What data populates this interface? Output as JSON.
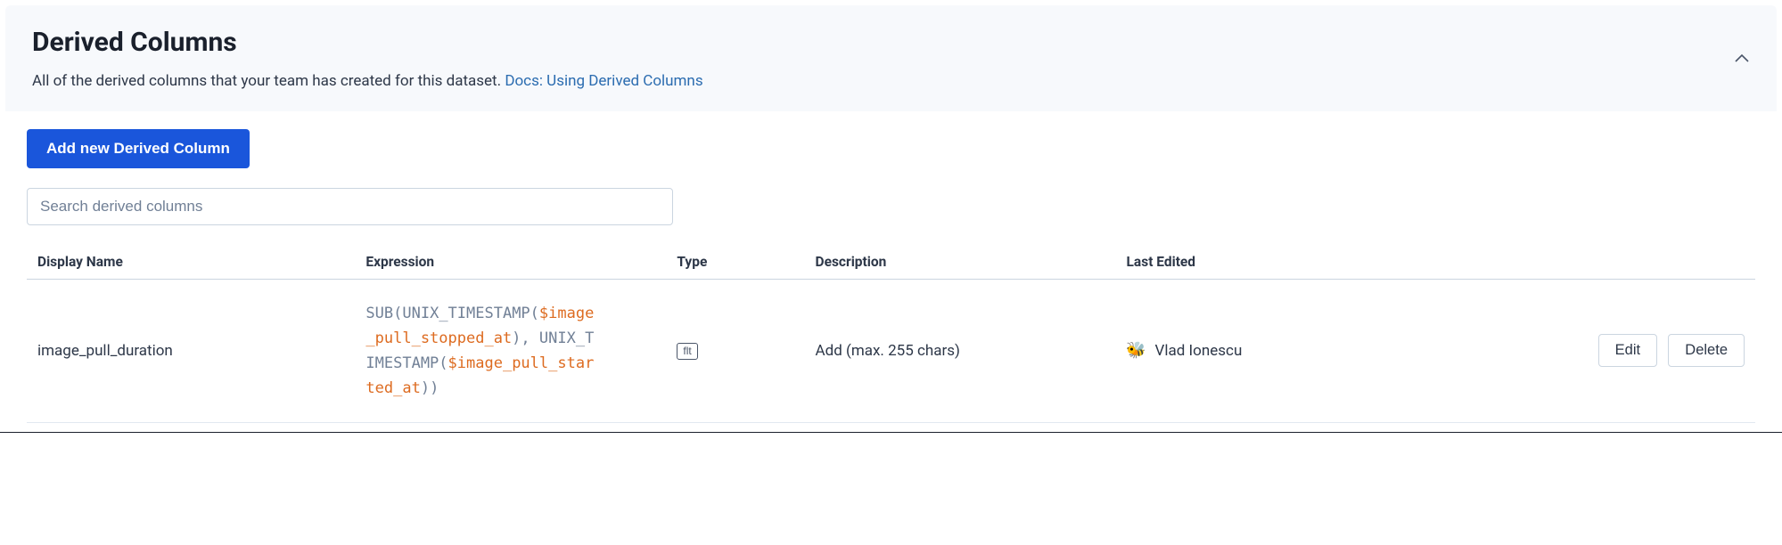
{
  "header": {
    "title": "Derived Columns",
    "subtitle": "All of the derived columns that your team has created for this dataset. ",
    "docs_link_label": "Docs: Using Derived Columns"
  },
  "toolbar": {
    "add_button_label": "Add new Derived Column",
    "search_placeholder": "Search derived columns"
  },
  "table": {
    "headers": {
      "display_name": "Display Name",
      "expression": "Expression",
      "type": "Type",
      "description": "Description",
      "last_edited": "Last Edited"
    },
    "rows": [
      {
        "display_name": "image_pull_duration",
        "expression_tokens": [
          {
            "t": "func",
            "v": "SUB"
          },
          {
            "t": "paren",
            "v": "("
          },
          {
            "t": "func",
            "v": "UNIX_TIMESTAMP"
          },
          {
            "t": "paren",
            "v": "("
          },
          {
            "t": "var",
            "v": "$image_pull_stopped_at"
          },
          {
            "t": "paren",
            "v": ")"
          },
          {
            "t": "comma",
            "v": ", "
          },
          {
            "t": "func",
            "v": "UNIX_TIMESTAMP"
          },
          {
            "t": "paren",
            "v": "("
          },
          {
            "t": "var",
            "v": "$image_pull_started_at"
          },
          {
            "t": "paren",
            "v": ")"
          },
          {
            "t": "paren",
            "v": ")"
          }
        ],
        "type_badge": "flt",
        "description_placeholder": "Add (max. 255 chars)",
        "last_edited_user": "Vlad Ionescu",
        "actions": {
          "edit": "Edit",
          "delete": "Delete"
        }
      }
    ]
  }
}
